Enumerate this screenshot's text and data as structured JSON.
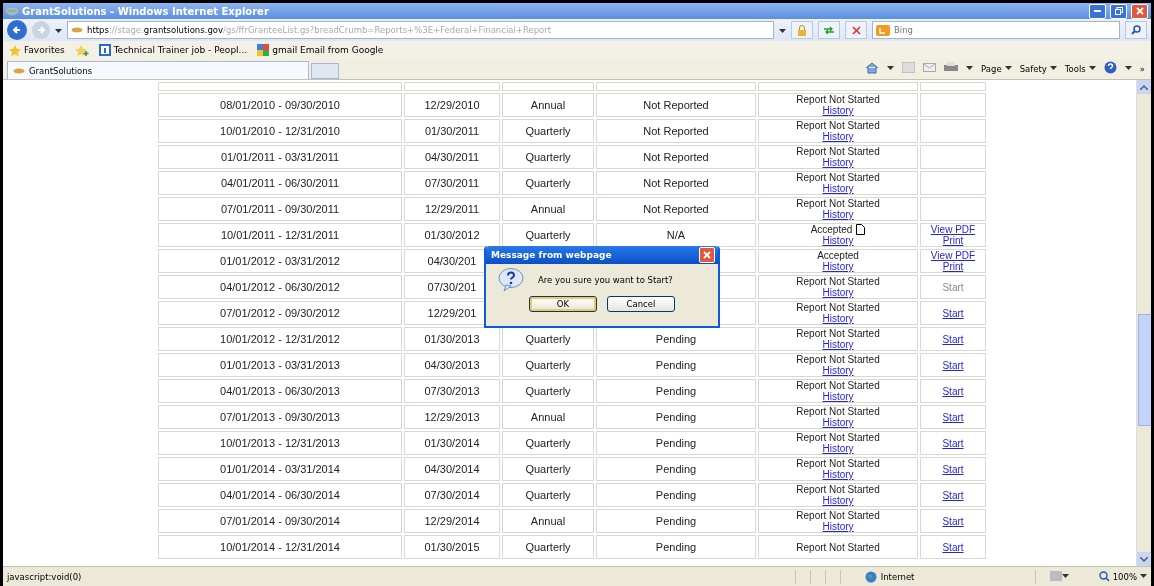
{
  "window": {
    "title": "GrantSolutions - Windows Internet Explorer"
  },
  "address_bar": {
    "url_prefix": "https://stage.",
    "url_domain": "grantsolutions.gov",
    "url_path": "/gs/ffrGranteeList.gs?breadCrumb=Reports+%3E+Federal+Financial+Report"
  },
  "search": {
    "placeholder": "Bing"
  },
  "favorites_bar": {
    "label": "Favorites",
    "items": [
      "Technical Trainer job - Peopl...",
      "gmail Email from Google"
    ]
  },
  "tabs": [
    {
      "label": "GrantSolutions",
      "selected": true
    }
  ],
  "command_bar": {
    "menus": [
      "Page",
      "Safety",
      "Tools"
    ],
    "overflow": "»"
  },
  "table": {
    "rows": [
      {
        "period": "08/01/2010 - 09/30/2010",
        "due": "12/29/2010",
        "type": "Annual",
        "status": "Not Reported",
        "report": "Report Not Started",
        "history": "History",
        "actions": []
      },
      {
        "period": "10/01/2010 - 12/31/2010",
        "due": "01/30/2011",
        "type": "Quarterly",
        "status": "Not Reported",
        "report": "Report Not Started",
        "history": "History",
        "actions": []
      },
      {
        "period": "01/01/2011 - 03/31/2011",
        "due": "04/30/2011",
        "type": "Quarterly",
        "status": "Not Reported",
        "report": "Report Not Started",
        "history": "History",
        "actions": []
      },
      {
        "period": "04/01/2011 - 06/30/2011",
        "due": "07/30/2011",
        "type": "Quarterly",
        "status": "Not Reported",
        "report": "Report Not Started",
        "history": "History",
        "actions": []
      },
      {
        "period": "07/01/2011 - 09/30/2011",
        "due": "12/29/2011",
        "type": "Annual",
        "status": "Not Reported",
        "report": "Report Not Started",
        "history": "History",
        "actions": []
      },
      {
        "period": "10/01/2011 - 12/31/2011",
        "due": "01/30/2012",
        "type": "Quarterly",
        "status": "N/A",
        "report": "Accepted",
        "document": true,
        "history": "History",
        "actions": [
          {
            "label": "View PDF",
            "disabled": false
          },
          {
            "label": "Print",
            "disabled": false
          }
        ]
      },
      {
        "period": "01/01/2012 - 03/31/2012",
        "due": "04/30/201",
        "report": "Accepted",
        "history": "History",
        "actions": [
          {
            "label": "View PDF",
            "disabled": false
          },
          {
            "label": "Print",
            "disabled": false
          }
        ]
      },
      {
        "period": "04/01/2012 - 06/30/2012",
        "due": "07/30/201",
        "report": "Report Not Started",
        "history": "History",
        "actions": [
          {
            "label": "Start",
            "disabled": true
          }
        ]
      },
      {
        "period": "07/01/2012 - 09/30/2012",
        "due": "12/29/201",
        "report": "Report Not Started",
        "history": "History",
        "actions": [
          {
            "label": "Start",
            "disabled": false
          }
        ]
      },
      {
        "period": "10/01/2012 - 12/31/2012",
        "due": "01/30/2013",
        "type": "Quarterly",
        "status": "Pending",
        "report": "Report Not Started",
        "history": "History",
        "actions": [
          {
            "label": "Start",
            "disabled": false
          }
        ]
      },
      {
        "period": "01/01/2013 - 03/31/2013",
        "due": "04/30/2013",
        "type": "Quarterly",
        "status": "Pending",
        "report": "Report Not Started",
        "history": "History",
        "actions": [
          {
            "label": "Start",
            "disabled": false
          }
        ]
      },
      {
        "period": "04/01/2013 - 06/30/2013",
        "due": "07/30/2013",
        "type": "Quarterly",
        "status": "Pending",
        "report": "Report Not Started",
        "history": "History",
        "actions": [
          {
            "label": "Start",
            "disabled": false
          }
        ]
      },
      {
        "period": "07/01/2013 - 09/30/2013",
        "due": "12/29/2013",
        "type": "Annual",
        "status": "Pending",
        "report": "Report Not Started",
        "history": "History",
        "actions": [
          {
            "label": "Start",
            "disabled": false
          }
        ]
      },
      {
        "period": "10/01/2013 - 12/31/2013",
        "due": "01/30/2014",
        "type": "Quarterly",
        "status": "Pending",
        "report": "Report Not Started",
        "history": "History",
        "actions": [
          {
            "label": "Start",
            "disabled": false
          }
        ]
      },
      {
        "period": "01/01/2014 - 03/31/2014",
        "due": "04/30/2014",
        "type": "Quarterly",
        "status": "Pending",
        "report": "Report Not Started",
        "history": "History",
        "actions": [
          {
            "label": "Start",
            "disabled": false
          }
        ]
      },
      {
        "period": "04/01/2014 - 06/30/2014",
        "due": "07/30/2014",
        "type": "Quarterly",
        "status": "Pending",
        "report": "Report Not Started",
        "history": "History",
        "actions": [
          {
            "label": "Start",
            "disabled": false
          }
        ]
      },
      {
        "period": "07/01/2014 - 09/30/2014",
        "due": "12/29/2014",
        "type": "Annual",
        "status": "Pending",
        "report": "Report Not Started",
        "history": "History",
        "actions": [
          {
            "label": "Start",
            "disabled": false
          }
        ]
      },
      {
        "period": "10/01/2014 - 12/31/2014",
        "due": "01/30/2015",
        "type": "Quarterly",
        "status": "Pending",
        "report": "Report Not Started",
        "actions": [
          {
            "label": "Start",
            "disabled": false
          }
        ]
      }
    ]
  },
  "dialog": {
    "title": "Message from webpage",
    "message": "Are you sure you want to Start?",
    "buttons": [
      {
        "label": "OK",
        "selected": true
      },
      {
        "label": "Cancel",
        "selected": false
      }
    ]
  },
  "status_bar": {
    "text": "javascript:void(0)",
    "zone": "Internet",
    "zoom": "100%"
  }
}
